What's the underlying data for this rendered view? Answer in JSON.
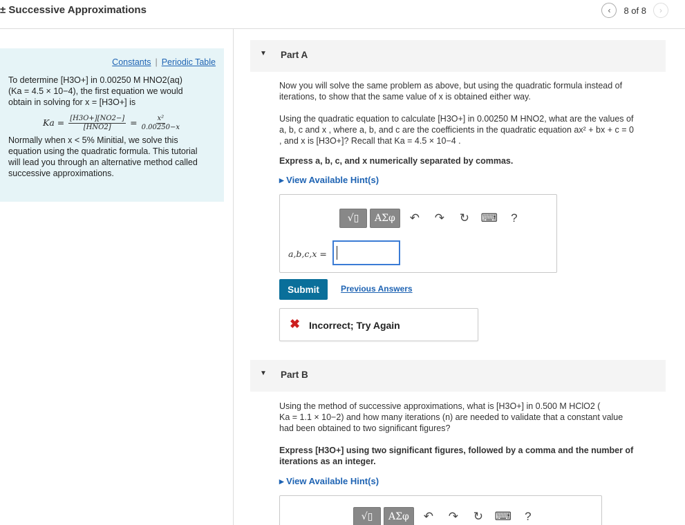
{
  "header": {
    "title": "± Successive Approximations",
    "pager": "8 of 8",
    "prev_icon": "chevron-left-icon",
    "next_icon": "chevron-right-icon"
  },
  "sidebar": {
    "links": [
      "Constants",
      "Periodic Table"
    ],
    "intro_1": "To determine [H3O+] in 0.00250 M HNO2(aq)",
    "intro_2": "(Ka = 4.5 × 10−4), the first equation we would",
    "intro_3": "obtain in solving for x = [H3O+] is",
    "ka_label": "Ka =",
    "frac1_num": "[H3O+][NO2−]",
    "frac1_den": "[HNO2]",
    "eq": "=",
    "frac2_num": "x²",
    "frac2_den": "0.00250−x",
    "outro_1": "Normally when x < 5% Minitial, we solve this",
    "outro_2": "equation using the quadratic formula. This tutorial",
    "outro_3": "will lead you through an alternative method called",
    "outro_4": "successive approximations."
  },
  "partA": {
    "label": "Part A",
    "para1_line1": "Now you will solve the same problem as above, but using the quadratic formula instead of",
    "para1_line2": "iterations, to show that the same value of x is obtained either way.",
    "para2_line1": "Using the quadratic equation to calculate [H3O+] in 0.00250 M HNO2, what are the values of",
    "para2_line2": "a, b, c and x , where a, b, and c are the coefficients in the quadratic equation ax² + bx + c = 0",
    "para2_line3": ", and x is [H3O+]? Recall that Ka = 4.5 × 10−4 .",
    "express": "Express a, b, c, and x numerically separated by commas.",
    "hint": "▸ View Available Hint(s)",
    "answer_label": "a,b,c,x =",
    "submit": "Submit",
    "previous_answers": "Previous Answers",
    "feedback": "Incorrect; Try Again"
  },
  "partB": {
    "label": "Part B",
    "para_line1": "Using the method of successive approximations, what is [H3O+] in 0.500 M HClO2 (",
    "para_line2": "Ka = 1.1 × 10−2) and how many iterations (n) are needed to validate that a constant value",
    "para_line3": "had been obtained to two significant figures?",
    "express_line1": "Express [H3O+] using two significant figures, followed by a comma and the number of",
    "express_line2": "iterations as an integer.",
    "hint": "▸ View Available Hint(s)"
  },
  "toolbar": {
    "templates": "√▯",
    "greek": "ΑΣφ",
    "undo_icon": "undo-icon",
    "redo_icon": "redo-icon",
    "reset_icon": "reset-icon",
    "keyboard_icon": "keyboard-icon",
    "help": "?"
  },
  "colors": {
    "accent": "#1e63b3",
    "submit": "#0a6f9a",
    "sidebar_bg": "#e6f4f7",
    "error": "#cc1f1f"
  }
}
